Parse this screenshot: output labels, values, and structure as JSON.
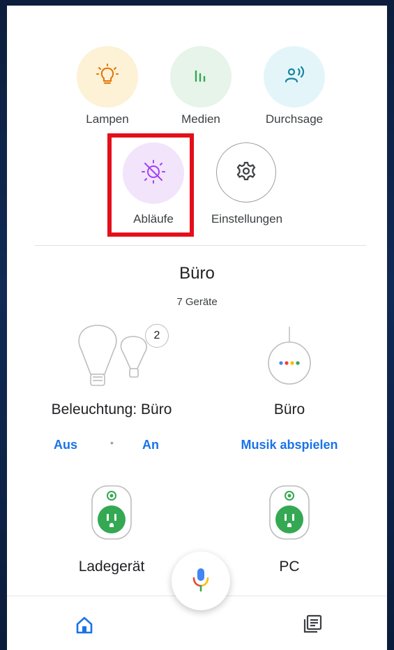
{
  "shortcuts": [
    {
      "label": "Lampen",
      "icon": "lightbulb-icon",
      "bg": "#fdf1d6",
      "color": "#e37400"
    },
    {
      "label": "Medien",
      "icon": "equalizer-icon",
      "bg": "#e6f4ea",
      "color": "#34a853"
    },
    {
      "label": "Durchsage",
      "icon": "broadcast-icon",
      "bg": "#e4f5fa",
      "color": "#12859c"
    },
    {
      "label": "Abläufe",
      "icon": "routine-sun-icon",
      "bg": "#f1e4fb",
      "color": "#a142f4"
    },
    {
      "label": "Einstellungen",
      "icon": "gear-icon",
      "bg": "#ffffff",
      "color": "#5f6368"
    }
  ],
  "room": {
    "name": "Büro",
    "device_count": "7 Geräte"
  },
  "devices": [
    {
      "name": "Beleuchtung: Büro",
      "badge": "2",
      "actions": [
        "Aus",
        "An"
      ],
      "separator": "•"
    },
    {
      "name": "Büro",
      "action": "Musik abspielen"
    },
    {
      "name": "Ladegerät",
      "icon": "smart-plug-icon"
    },
    {
      "name": "PC",
      "icon": "smart-plug-icon"
    }
  ],
  "colors": {
    "accent": "#1a73e8",
    "highlight": "#e3101a",
    "plug": "#34a853"
  },
  "nav": {
    "home_icon": "home-icon",
    "feed_icon": "feed-icon",
    "mic_icon": "microphone-icon"
  }
}
